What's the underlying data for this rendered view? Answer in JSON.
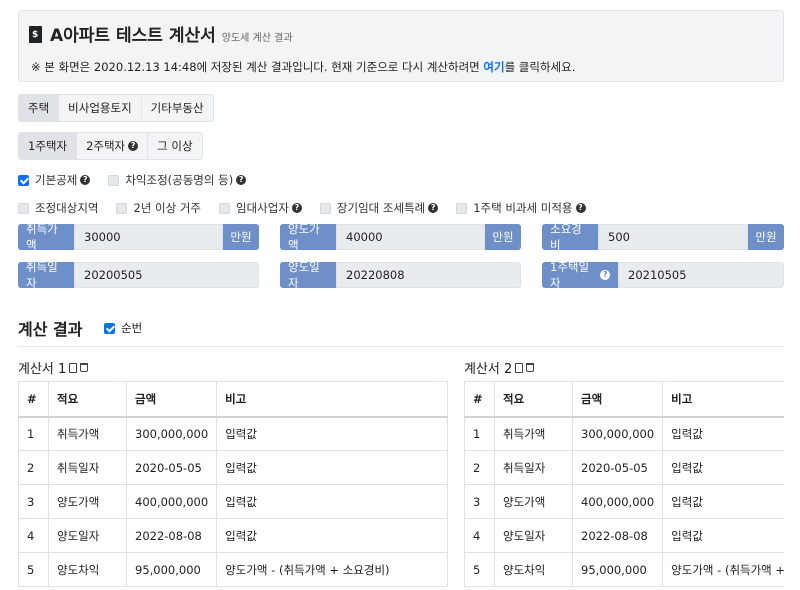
{
  "header": {
    "icon": "file-invoice-dollar-icon",
    "title": "A아파트 테스트 계산서",
    "subtitle": "양도세 계산 결과",
    "notice_prefix": "※ 본 화면은 2020.12.13 14:48에 저장된 계산 결과입니다. 현재 기준으로 다시 계산하려면 ",
    "notice_link": "여기",
    "notice_suffix": "를 클릭하세요."
  },
  "property_tabs": [
    "주택",
    "비사업용토지",
    "기타부동산"
  ],
  "house_tabs": [
    "1주택자",
    "2주택자",
    "그 이상"
  ],
  "options_row1": [
    {
      "label": "기본공제",
      "checked": true
    },
    {
      "label": "차익조정(공동명의 등)",
      "checked": false
    }
  ],
  "options_row2": [
    {
      "label": "조정대상지역",
      "checked": false
    },
    {
      "label": "2년 이상 거주",
      "checked": false
    },
    {
      "label": "임대사업자",
      "checked": false
    },
    {
      "label": "장기임대 조세특례",
      "checked": false
    },
    {
      "label": "1주택 비과세 미적용",
      "checked": false
    }
  ],
  "fields": {
    "acq_price": {
      "label": "취득가액",
      "value": "30000",
      "unit": "만원"
    },
    "sale_price": {
      "label": "양도가액",
      "value": "40000",
      "unit": "만원"
    },
    "expense": {
      "label": "소요경비",
      "value": "500",
      "unit": "만원"
    },
    "acq_date": {
      "label": "취득일자",
      "value": "20200505"
    },
    "sale_date": {
      "label": "양도일자",
      "value": "20220808"
    },
    "one_house_date": {
      "label": "1주택일자",
      "value": "20210505"
    }
  },
  "result": {
    "title": "계산 결과",
    "order_label": "순번",
    "order_checked": true
  },
  "calc1": {
    "title": "계산서 1",
    "headers": [
      "#",
      "적요",
      "금액",
      "비고"
    ],
    "rows": [
      [
        "1",
        "취득가액",
        "300,000,000",
        "입력값"
      ],
      [
        "2",
        "취득일자",
        "2020-05-05",
        "입력값"
      ],
      [
        "3",
        "양도가액",
        "400,000,000",
        "입력값"
      ],
      [
        "4",
        "양도일자",
        "2022-08-08",
        "입력값"
      ],
      [
        "5",
        "양도차익",
        "95,000,000",
        "양도가액 - (취득가액 + 소요경비)"
      ]
    ]
  },
  "calc2": {
    "title": "계산서 2",
    "headers": [
      "#",
      "적요",
      "금액",
      "비고"
    ],
    "rows": [
      [
        "1",
        "취득가액",
        "300,000,000",
        "입력값"
      ],
      [
        "2",
        "취득일자",
        "2020-05-05",
        "입력값"
      ],
      [
        "3",
        "양도가액",
        "400,000,000",
        "입력값"
      ],
      [
        "4",
        "양도일자",
        "2022-08-08",
        "입력값"
      ],
      [
        "5",
        "양도차익",
        "95,000,000",
        "양도가액 - (취득가액 + 소요"
      ]
    ]
  }
}
